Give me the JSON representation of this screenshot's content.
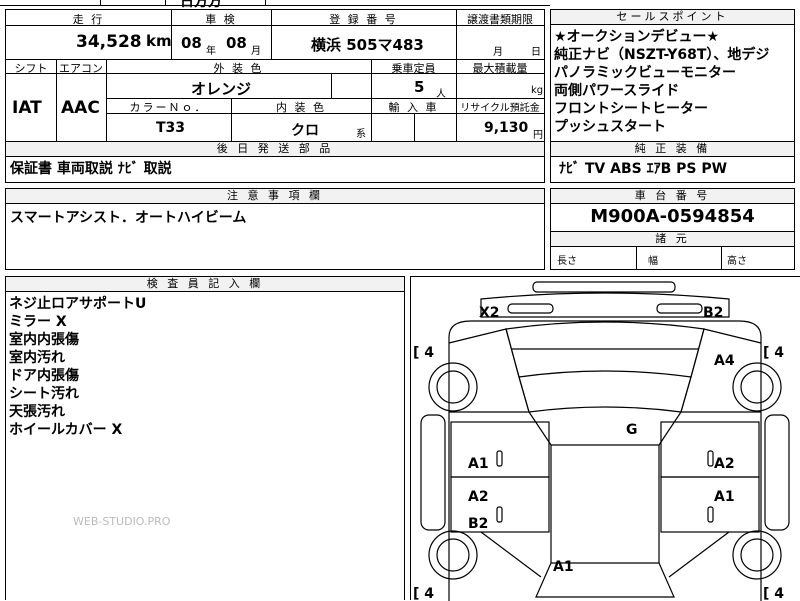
{
  "top_cut": {
    "a": "",
    "b": "日方方",
    "c": "",
    "d": ""
  },
  "labels": {
    "mileage": "走 行",
    "inspection": "車 検",
    "registration": "登 録 番 号",
    "transfer": "譲渡書類期限",
    "selling": "セールスポイント",
    "shift": "シフト",
    "aircon": "エアコン",
    "ext_color": "外 装 色",
    "capacity": "乗車定員",
    "max_load": "最大積載量",
    "color_no": "カラーＮｏ．",
    "int_color": "内 装 色",
    "import": "輸 入 車",
    "recycle": "リサイクル預託金",
    "docs_later": "後 日 発 送 部 品",
    "equipment": "純 正 装 備",
    "caution": "注 意 事 項 欄",
    "chassis": "車 台 番 号",
    "dimensions": "諸 元",
    "inspector": "検 査 員 記 入 欄"
  },
  "values": {
    "mileage": "34,528",
    "mileage_unit": "km",
    "insp_year": "08",
    "insp_year_unit": "年",
    "insp_month": "08",
    "insp_month_unit": "月",
    "plate": "横浜 505マ483",
    "transfer_month": "月",
    "transfer_day": "日",
    "shift": "IAT",
    "aircon": "AAC",
    "ext_color": "オレンジ",
    "capacity": "5",
    "capacity_unit": "人",
    "max_load_unit": "kg",
    "color_no": "T33",
    "int_color": "クロ",
    "int_color_unit": "系",
    "recycle": "9,130",
    "recycle_unit": "円",
    "docs_later": "保証書 車両取説 ﾅﾋﾞ 取説",
    "equipment": "ﾅﾋﾞ TV ABS ｴｱB PS PW",
    "caution": "スマートアシスト．オートハイビーム",
    "chassis": "M900A-0594854",
    "len": "長さ",
    "wid": "幅",
    "hgt": "高さ"
  },
  "selling_points": [
    "★オークションデビュー★",
    "純正ナビ（NSZT-Y68T）、地デジ",
    "パノラミックビューモニター",
    "両側パワースライド",
    "フロントシートヒーター",
    "プッシュスタート"
  ],
  "inspector_notes": [
    "ネジ止ロアサポートU",
    "ミラー X",
    "室内内張傷",
    "室内汚れ",
    "ドア内張傷",
    "シート汚れ",
    "天張汚れ",
    "ホイールカバー X"
  ],
  "watermark": "WEB-STUDIO.PRO",
  "diagram": {
    "tire_fl": "[ 4",
    "tire_fr": "[ 4",
    "tire_rl": "[ 4",
    "tire_rr": "[ 4",
    "marks": {
      "x2": "X2",
      "b2_top": "B2",
      "a4": "A4",
      "g": "G",
      "a1_l": "A1",
      "a2_r": "A2",
      "a2_l": "A2",
      "a1_r": "A1",
      "b2_l": "B2",
      "a1_b": "A1"
    }
  }
}
